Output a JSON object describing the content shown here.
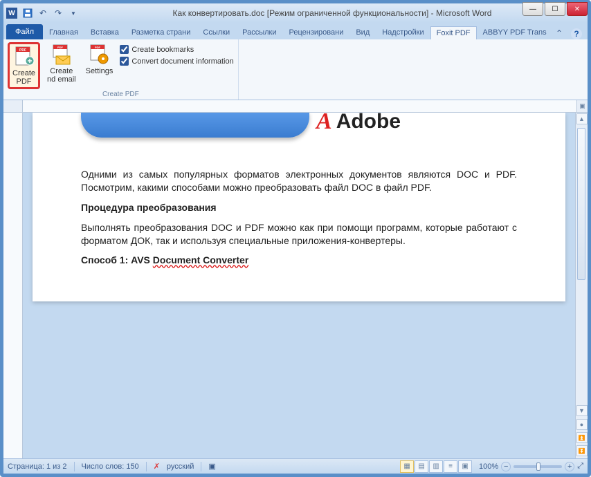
{
  "title": "Как конвертировать.doc [Режим ограниченной функциональности]  -  Microsoft Word",
  "tabs": {
    "file": "Файл",
    "items": [
      "Главная",
      "Вставка",
      "Разметка страни",
      "Ссылки",
      "Рассылки",
      "Рецензировани",
      "Вид",
      "Надстройки",
      "Foxit PDF",
      "ABBYY PDF Trans"
    ],
    "active": "Foxit PDF"
  },
  "ribbon": {
    "create_pdf": "Create\nPDF",
    "create_email": "Create\nnd email",
    "settings": "Settings",
    "check_bookmarks": "Create bookmarks",
    "check_docinfo": "Convert document information",
    "group_caption": "Create PDF"
  },
  "document": {
    "adobe": "Adobe",
    "p1": "Одними из самых популярных форматов электронных документов являются DOC и PDF. Посмотрим, какими способами можно преобразовать файл DOC в файл PDF.",
    "h1": "Процедура преобразования",
    "p2": "Выполнять преобразования DOC и PDF можно как при помощи программ, которые работают с форматом ДОК, так и используя специальные приложения-конвертеры.",
    "h2_pre": "Способ 1: AVS ",
    "h2_link": "Document Converter"
  },
  "status": {
    "page": "Страница: 1 из 2",
    "words": "Число слов: 150",
    "lang": "русский",
    "zoom": "100%"
  }
}
